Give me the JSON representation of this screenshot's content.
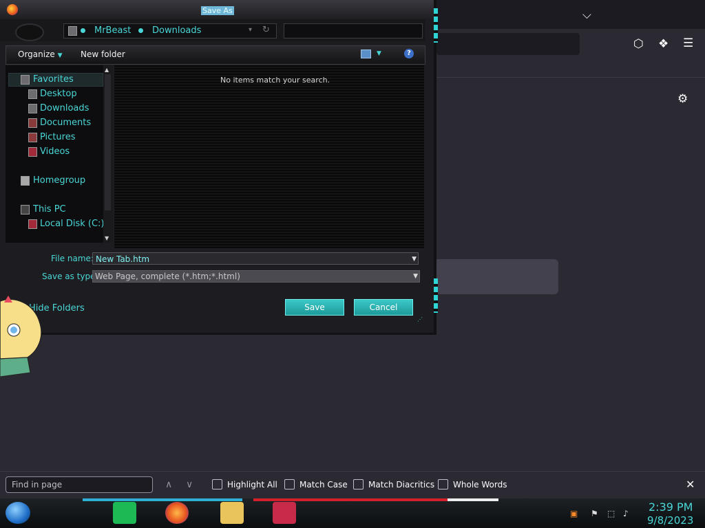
{
  "dialog": {
    "title": "Save As",
    "breadcrumbs": [
      "MrBeast",
      "Downloads"
    ],
    "toolbar": {
      "organize": "Organize",
      "new_folder": "New folder"
    },
    "nav": {
      "favorites": "Favorites",
      "desktop": "Desktop",
      "downloads": "Downloads",
      "documents": "Documents",
      "pictures": "Pictures",
      "videos": "Videos",
      "homegroup": "Homegroup",
      "this_pc": "This PC",
      "local_disk": "Local Disk (C:)"
    },
    "empty_message": "No items match your search.",
    "file_name_label": "File name:",
    "file_name_value": "New Tab.htm",
    "save_type_label": "Save as type:",
    "save_type_value": "Web Page, complete (*.htm;*.html)",
    "hide_folders": "Hide Folders",
    "save_button": "Save",
    "cancel_button": "Cancel"
  },
  "findbar": {
    "placeholder": "Find in page",
    "highlight_all": "Highlight All",
    "match_case": "Match Case",
    "match_diacritics": "Match Diacritics",
    "whole_words": "Whole Words"
  },
  "taskbar": {
    "time": "2:39 PM",
    "date": "9/8/2023"
  },
  "colors": {
    "accent": "#4ad6d6",
    "dialog_bg": "#1d1d21",
    "browser_bg": "#2b2a33"
  },
  "icons": {
    "browser_toolbar": [
      "pocket-icon",
      "extensions-icon",
      "menu-icon",
      "settings-gear-icon",
      "chevron-down-icon"
    ]
  }
}
